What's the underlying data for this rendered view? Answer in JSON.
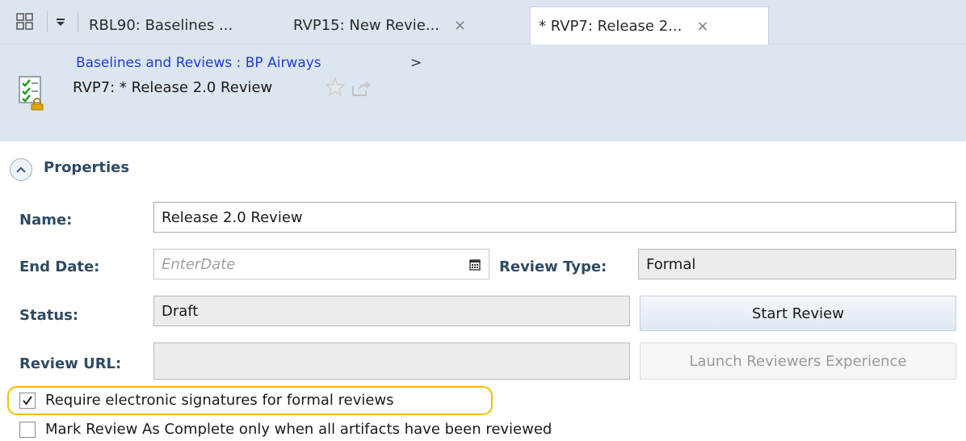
{
  "tabs": [
    {
      "label": "RBL90: Baselines ...",
      "closable": false,
      "active": false
    },
    {
      "label": "RVP15: New Revie...",
      "closable": true,
      "active": false
    },
    {
      "label": "* RVP7: Release 2...",
      "closable": true,
      "active": true
    }
  ],
  "tab_close_glyph": "×",
  "header": {
    "breadcrumb": "Baselines and Reviews : BP Airways",
    "breadcrumb_arrow": ">",
    "title": "RVP7: * Release 2.0 Review"
  },
  "section": {
    "title": "Properties"
  },
  "form": {
    "name_label": "Name:",
    "name_value": "Release 2.0 Review",
    "end_date_label": "End Date:",
    "end_date_placeholder": "EnterDate",
    "review_type_label": "Review Type:",
    "review_type_value": "Formal",
    "status_label": "Status:",
    "status_value": "Draft",
    "start_review_button": "Start Review",
    "review_url_label": "Review URL:",
    "review_url_value": "",
    "launch_button": "Launch Reviewers Experience"
  },
  "options": {
    "require_esig_label": "Require electronic signatures for formal reviews",
    "require_esig_checked": true,
    "mark_complete_label": "Mark Review As Complete only when all artifacts have been reviewed",
    "mark_complete_checked": false
  },
  "icons": {
    "grid": "grid-icon",
    "dropdown": "dropdown-icon",
    "close": "close-icon",
    "document": "review-document-icon",
    "star": "star-icon",
    "share": "share-icon",
    "collapse": "chevron-up-icon",
    "calendar": "calendar-icon",
    "check": "checkmark-icon"
  },
  "colors": {
    "link": "#1f3cd6",
    "label": "#2f4a63",
    "header_bg": "#dce6f0",
    "highlight": "#f0c000"
  }
}
